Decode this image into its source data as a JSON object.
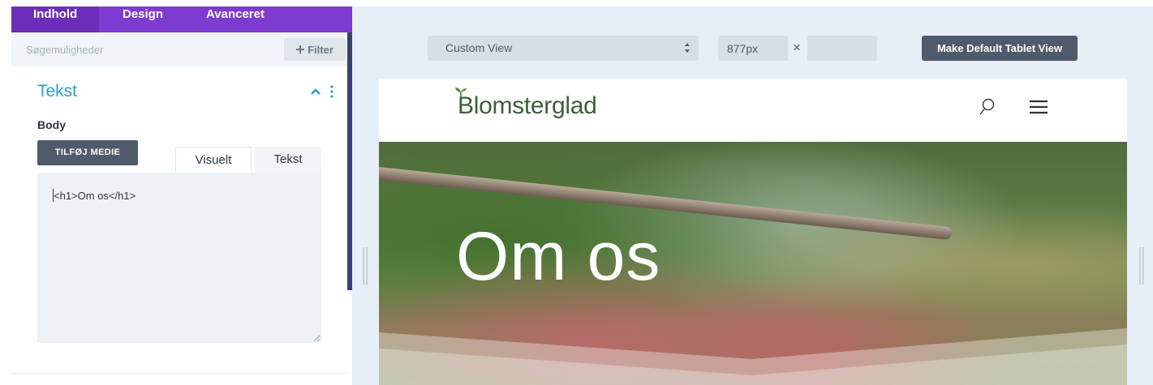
{
  "panel": {
    "tabs": [
      "Indhold",
      "Design",
      "Avanceret"
    ],
    "search_placeholder": "Søgemuligheder",
    "filter_label": "Filter",
    "section_title": "Tekst",
    "body_label": "Body",
    "add_media_label": "TILFØJ MEDIE",
    "editor_tabs": [
      "Visuelt",
      "Tekst"
    ],
    "code_content": "<h1>Om os</h1>"
  },
  "toolbar": {
    "view_select_value": "Custom View",
    "width_value": "877px",
    "times_sign": "×",
    "height_value": "",
    "default_button_label": "Make Default Tablet View"
  },
  "site": {
    "logo_text": "Blomsterglad",
    "hero_title": "Om os"
  },
  "colors": {
    "accent_purple": "#7e3bd0",
    "section_blue": "#2e9bd6",
    "button_slate": "#4f5b6a",
    "logo_green": "#3d5e3a"
  },
  "icons": [
    "plus-icon",
    "chevron-up-icon",
    "kebab-menu-icon",
    "select-arrows-icon",
    "search-icon",
    "hamburger-menu-icon",
    "drag-handle-icon",
    "resize-grip-icon",
    "sprout-icon"
  ]
}
